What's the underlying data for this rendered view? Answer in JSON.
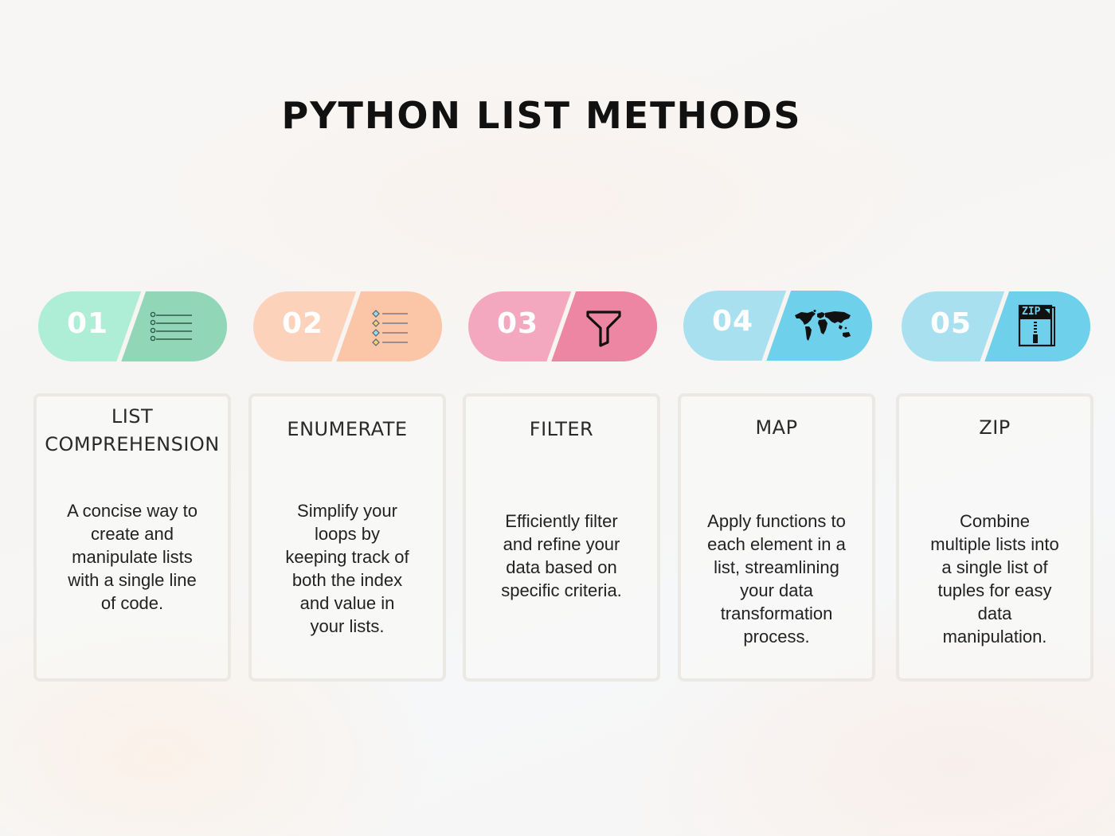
{
  "title": "PYTHON LIST METHODS",
  "colors": {
    "green_light": "#aeeed6",
    "green_dark": "#92d6b8",
    "peach_light": "#fcd2bb",
    "peach_dark": "#fbc6a8",
    "pink_light": "#f4a8bf",
    "pink_dark": "#ec86a2",
    "blue_light": "#a8e0f0",
    "blue_dark": "#6fd0ec"
  },
  "steps": [
    {
      "number": "01",
      "icon": "bulleted-list-icon",
      "heading_lines": [
        "LIST",
        "COMPREHENSION"
      ],
      "description_lines": [
        "A concise way to",
        "create and",
        "manipulate lists",
        "with a single line",
        "of code."
      ]
    },
    {
      "number": "02",
      "icon": "numbered-list-icon",
      "heading_lines": [
        "ENUMERATE"
      ],
      "description_lines": [
        "Simplify your",
        "loops by",
        "keeping track of",
        "both the index",
        "and value in",
        "your lists."
      ]
    },
    {
      "number": "03",
      "icon": "filter-funnel-icon",
      "heading_lines": [
        "FILTER"
      ],
      "description_lines": [
        "Efficiently filter",
        "and refine your",
        "data based on",
        "specific criteria."
      ]
    },
    {
      "number": "04",
      "icon": "world-map-icon",
      "heading_lines": [
        "MAP"
      ],
      "description_lines": [
        "Apply functions to",
        "each element in a",
        "list, streamlining",
        "your data",
        "transformation",
        "process."
      ]
    },
    {
      "number": "05",
      "icon": "zip-file-icon",
      "zip_label": "ZIP",
      "heading_lines": [
        "ZIP"
      ],
      "description_lines": [
        "Combine",
        "multiple lists into",
        "a single list of",
        "tuples for easy",
        "data",
        "manipulation."
      ]
    }
  ]
}
